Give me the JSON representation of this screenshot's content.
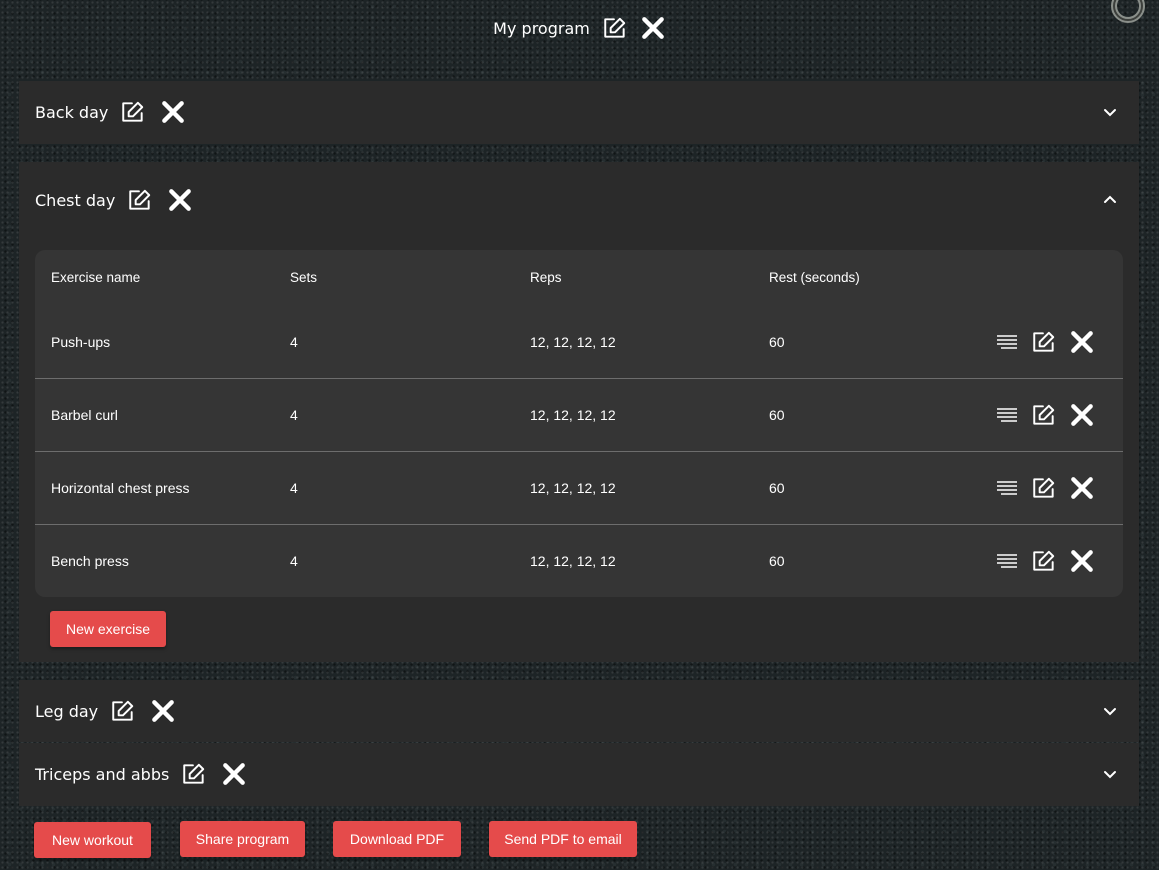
{
  "header": {
    "title": "My program"
  },
  "workouts": [
    {
      "name": "Back day",
      "expanded": false
    },
    {
      "name": "Chest day",
      "expanded": true
    },
    {
      "name": "Leg day",
      "expanded": false
    },
    {
      "name": "Triceps and abbs",
      "expanded": false
    }
  ],
  "table": {
    "headers": [
      "Exercise name",
      "Sets",
      "Reps",
      "Rest (seconds)"
    ],
    "rows": [
      {
        "name": "Push-ups",
        "sets": "4",
        "reps": "12, 12, 12, 12",
        "rest": "60"
      },
      {
        "name": "Barbel curl",
        "sets": "4",
        "reps": "12, 12, 12, 12",
        "rest": "60"
      },
      {
        "name": "Horizontal chest press",
        "sets": "4",
        "reps": "12, 12, 12, 12",
        "rest": "60"
      },
      {
        "name": "Bench press",
        "sets": "4",
        "reps": "12, 12, 12, 12",
        "rest": "60"
      }
    ]
  },
  "buttons": {
    "new_exercise": "New exercise",
    "new_workout": "New workout",
    "share_program": "Share program",
    "download_pdf": "Download PDF",
    "send_pdf": "Send PDF to email"
  },
  "colors": {
    "accent": "#e54b4b",
    "panel": "#2b2b2b",
    "card": "#353535"
  },
  "icons": [
    "edit-icon",
    "close-icon",
    "chevron-down-icon",
    "chevron-up-icon",
    "notes-icon"
  ]
}
